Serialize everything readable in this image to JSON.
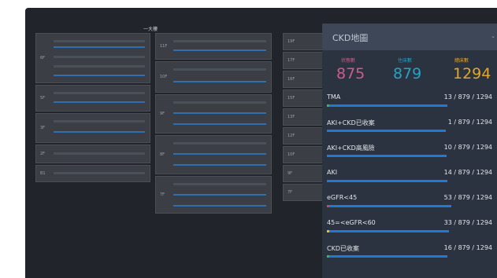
{
  "background": {
    "title": "一大樓",
    "column1": [
      "6F",
      "5F",
      "3F",
      "2F",
      "B1"
    ],
    "column2": [
      "11F",
      "10F",
      "9F",
      "8F",
      "7F"
    ],
    "column3": [
      "19F",
      "17F",
      "16F",
      "15F",
      "13F",
      "12F",
      "10F",
      "9F",
      "7F"
    ]
  },
  "panel": {
    "title": "CKD地圖",
    "stats": [
      {
        "label": "状態數",
        "value": "875",
        "color": "#d05b8a"
      },
      {
        "label": "住床數",
        "value": "879",
        "color": "#23a5c6"
      },
      {
        "label": "總床數",
        "value": "1294",
        "color": "#e3a728"
      }
    ],
    "rows": [
      {
        "label": "TMA",
        "value": "13 / 879 / 1294",
        "fraction": 0.0148,
        "marker_color": "#2fbf4f"
      },
      {
        "label": "AKI+CKD已收案",
        "value": "1 / 879 / 1294",
        "fraction": 0.0011,
        "marker_color": "#1f7ad6"
      },
      {
        "label": "AKI+CKD高風險",
        "value": "10 / 879 / 1294",
        "fraction": 0.0114,
        "marker_color": "#1f7ad6"
      },
      {
        "label": "AKI",
        "value": "14 / 879 / 1294",
        "fraction": 0.0159,
        "marker_color": "#1f7ad6"
      },
      {
        "label": "eGFR<45",
        "value": "53 / 879 / 1294",
        "fraction": 0.0603,
        "marker_color": "#d64545"
      },
      {
        "label": "45=<eGFR<60",
        "value": "33 / 879 / 1294",
        "fraction": 0.0375,
        "marker_color": "#e3c428"
      },
      {
        "label": "CKD已收案",
        "value": "16 / 879 / 1294",
        "fraction": 0.0182,
        "marker_color": "#2fbf4f"
      }
    ]
  }
}
